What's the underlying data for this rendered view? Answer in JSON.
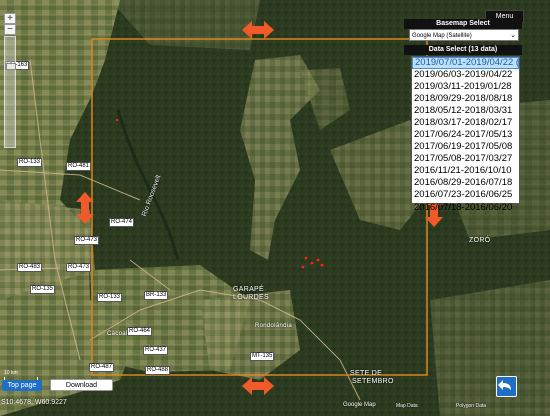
{
  "menu": {
    "label": "Menu"
  },
  "basemap": {
    "title": "Basemap Select",
    "selected": "Google Map (Satellite)"
  },
  "data_select": {
    "title": "Data Select (13 data)",
    "items": [
      "2019/07/01-2019/04/22 (QL)",
      "2019/06/03-2019/04/22",
      "2019/03/11-2019/01/28",
      "2018/09/29-2018/08/18",
      "2018/05/12-2018/03/31",
      "2018/03/17-2018/02/17",
      "2017/06/24-2017/05/13",
      "2017/06/19-2017/05/08",
      "2017/05/08-2017/03/27",
      "2016/11/21-2016/10/10",
      "2016/08/29-2016/07/18",
      "2016/07/23-2016/06/25",
      "2016/07/18-2016/06/20"
    ],
    "selected_index": 0
  },
  "map": {
    "road_labels": [
      "BR-163",
      "BR-163",
      "RO-133",
      "RO-481",
      "RO-474",
      "RO-473",
      "RO-483",
      "RO-473",
      "RO-135",
      "RO-133",
      "RO-133",
      "RO-133",
      "BR-133",
      "RO-464",
      "RO-437",
      "MT-135",
      "MT-133",
      "RO-135",
      "RO-487",
      "RO-488",
      "RO-420"
    ],
    "places": {
      "garape": "GARAPÉ",
      "lourdes": "LOURDES",
      "sete": "SETE DE",
      "setembro": "SETEMBRO",
      "zoro": "ZORÓ",
      "riozinho": "Rio Roosevelt",
      "rondolandia": "Rondolândia",
      "town": "Cacoal"
    }
  },
  "scale": {
    "label": "10 km"
  },
  "coordinates": "S10.4678, W60.9227",
  "buttons": {
    "top_page": "Top page",
    "download": "Download"
  },
  "attribution": {
    "google": "Google Map",
    "data1": "Map Data",
    "data2": "Polygon Data"
  },
  "colors": {
    "aoi_outline": "#e58a1e",
    "arrow": "#f05a28",
    "alert_points": "#ff2020",
    "button_blue": "#1f6fc5"
  }
}
